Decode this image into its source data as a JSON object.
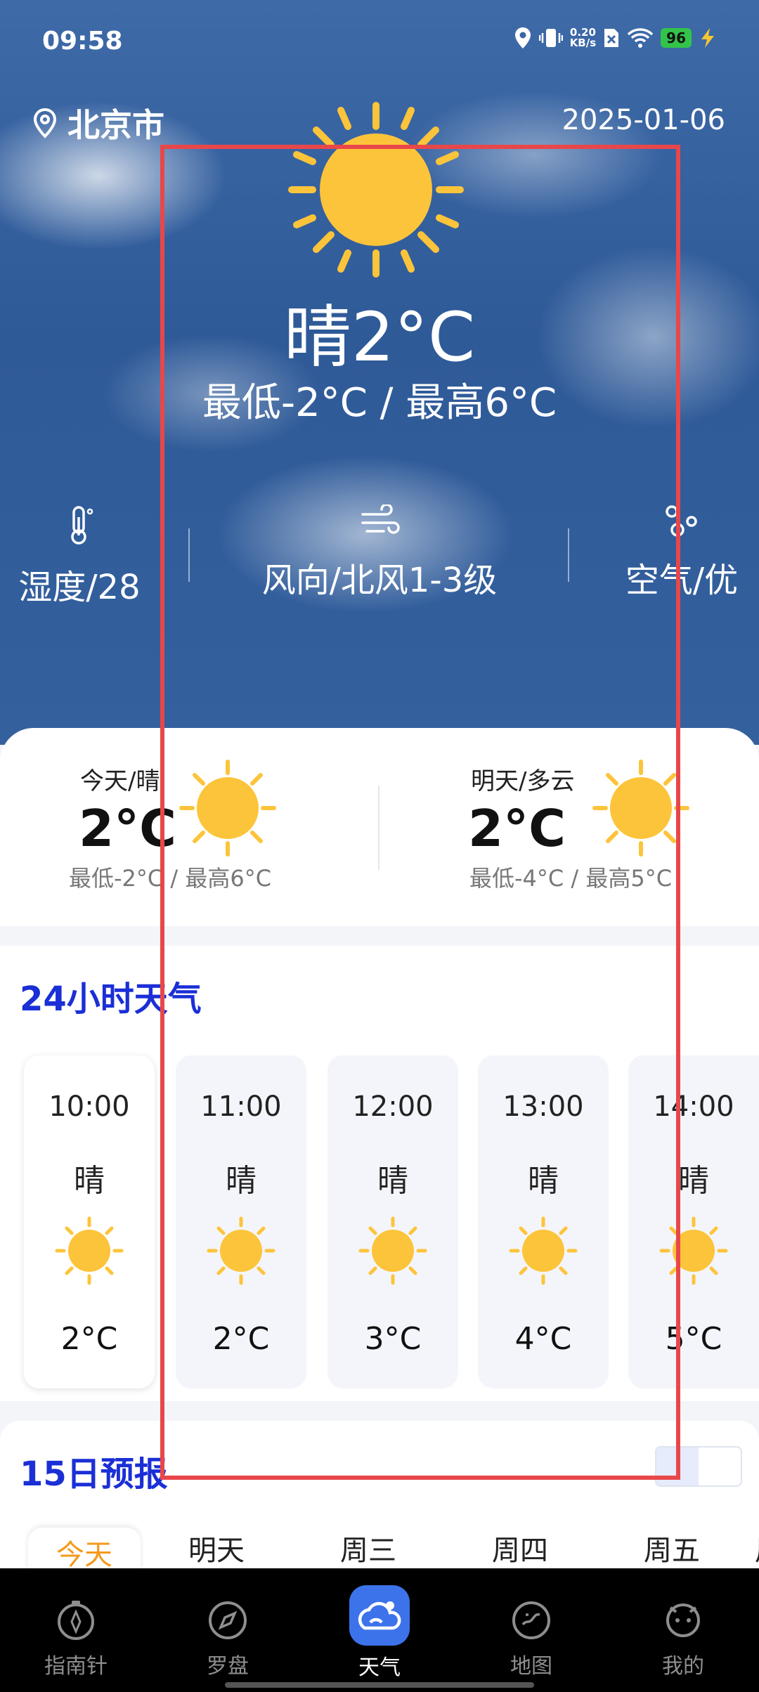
{
  "status_bar": {
    "time": "09:58",
    "net_speed_value": "0.20",
    "net_speed_unit": "KB/s",
    "battery": "96",
    "icons": [
      "location-icon",
      "vibrate-icon",
      "sim-off-icon",
      "wifi-icon",
      "battery-icon",
      "charging-icon"
    ]
  },
  "header": {
    "city": "北京市",
    "date": "2025-01-06",
    "condition_temp": "晴2°C",
    "low_high": "最低-2°C  /  最高6°C"
  },
  "stats": {
    "humidity": "湿度/28",
    "wind": "风向/北风1-3级",
    "air": "空气/优"
  },
  "days": {
    "today_label": "今天/晴",
    "today_temp": "2°C",
    "today_range": "最低-2°C / 最高6°C",
    "tomorrow_label": "明天/多云",
    "tomorrow_temp": "2°C",
    "tomorrow_range": "最低-4°C / 最高5°C"
  },
  "hourly": {
    "title": "24小时天气",
    "items": [
      {
        "time": "10:00",
        "cond": "晴",
        "temp": "2°C"
      },
      {
        "time": "11:00",
        "cond": "晴",
        "temp": "2°C"
      },
      {
        "time": "12:00",
        "cond": "晴",
        "temp": "3°C"
      },
      {
        "time": "13:00",
        "cond": "晴",
        "temp": "4°C"
      },
      {
        "time": "14:00",
        "cond": "晴",
        "temp": "5°C"
      }
    ]
  },
  "forecast": {
    "title": "15日预报",
    "tabs": [
      "今天",
      "明天",
      "周三",
      "周四",
      "周五",
      "周"
    ]
  },
  "nav": {
    "items": [
      "指南针",
      "罗盘",
      "天气",
      "地图",
      "我的"
    ],
    "active": "天气"
  },
  "colors": {
    "accent_blue": "#1a2fd6",
    "sun": "#fcc43a",
    "overlay_red": "#e8474a",
    "nav_active": "#3d73ea"
  }
}
